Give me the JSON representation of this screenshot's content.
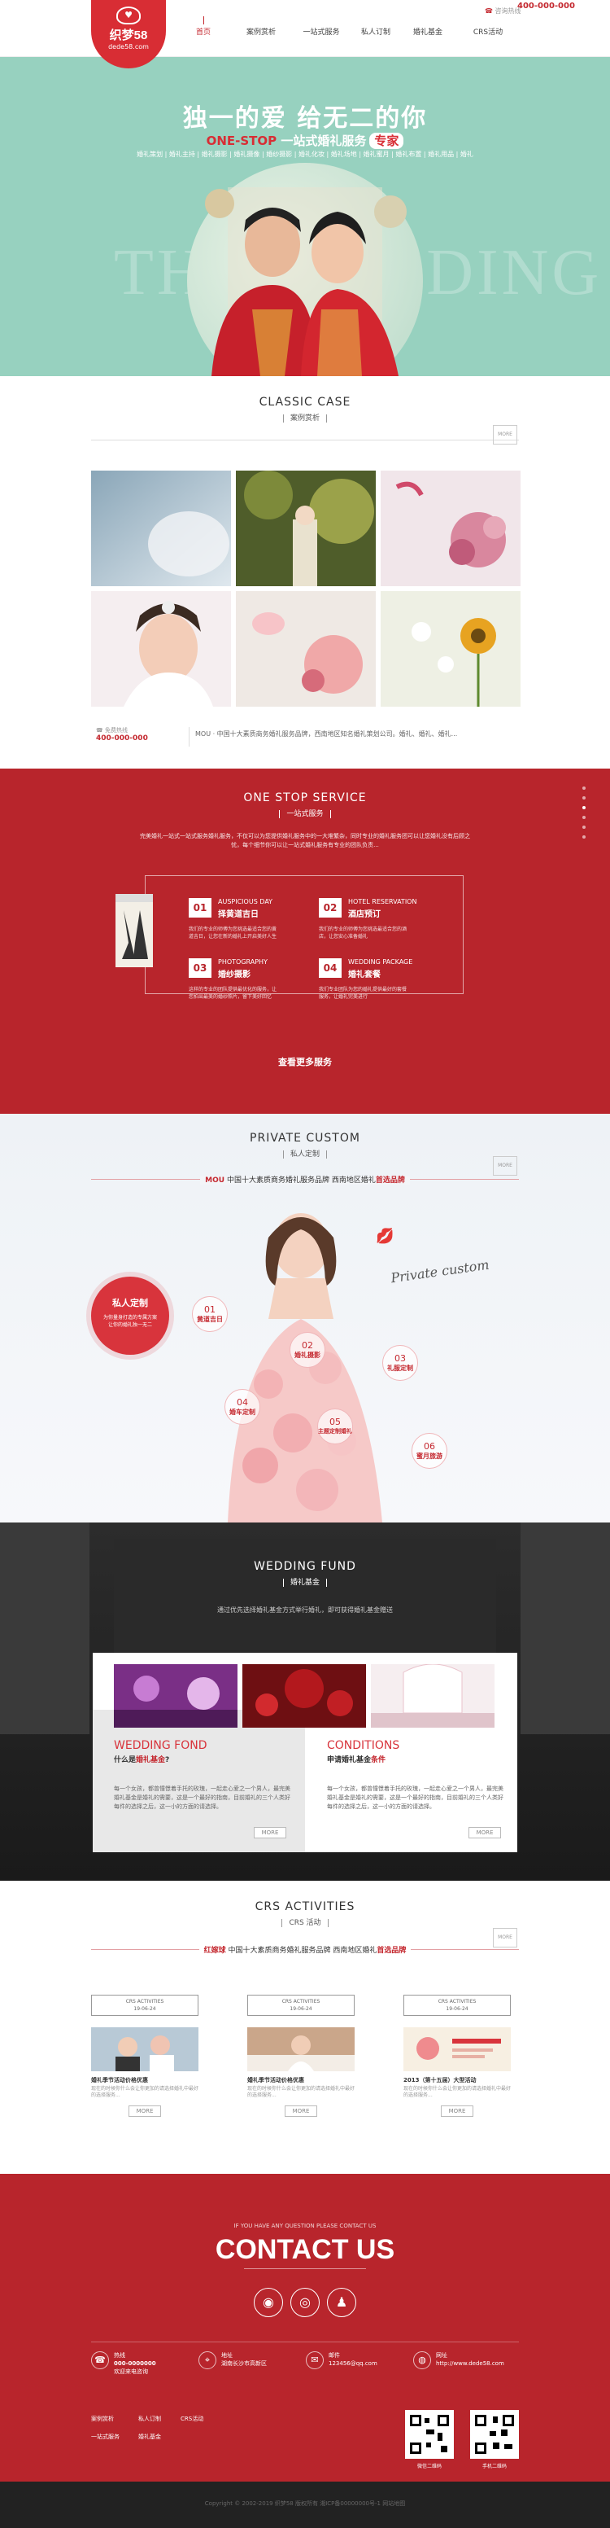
{
  "header": {
    "logo_title": "织梦58",
    "logo_url": "dede58.com",
    "nav": [
      {
        "label": "首页",
        "active": true
      },
      {
        "label": "案例赏析"
      },
      {
        "label": "一站式服务"
      },
      {
        "label": "私人订制"
      },
      {
        "label": "婚礼基金"
      },
      {
        "label": "CRS活动"
      }
    ],
    "hotline_label": "咨询热线",
    "hotline": "400-000-000"
  },
  "hero": {
    "title": "独一的爱 给无二的你",
    "sub_en": "ONE-STOP",
    "sub_cn": "一站式婚礼服务",
    "sub_tag": "专家",
    "desc": "婚礼策划 | 婚礼主持 | 婚礼摄影 | 婚礼摄像 | 婚纱摄影 | 婚礼化妆 | 婚礼场地 | 婚礼蜜月 | 婚礼布置 | 婚礼用品 | 婚礼",
    "watermark": "THE WEDDING",
    "colors": {
      "bg": "#97d1bf",
      "accent": "#d82d34"
    }
  },
  "classic": {
    "title_en": "CLASSIC CASE",
    "title_cn": "案例赏析",
    "more": "MORE",
    "hotline_label": "免费热线",
    "hotline": "400-000-000",
    "intro": "MOU · 中国十大素质商务婚礼服务品牌，西南地区知名婚礼策划公司。婚礼、婚礼、婚礼...",
    "thumbs": [
      "case-1",
      "case-2",
      "case-3",
      "case-4",
      "case-5",
      "case-6"
    ]
  },
  "onestop": {
    "title_en": "ONE STOP SERVICE",
    "title_cn": "一站式服务",
    "intro": "完美婚礼一站式一站式服务婚礼服务，不仅可以为您提供婚礼服务中的一大堆繁杂，同时专业的婚礼服务团可以让您婚礼没有后顾之忧，每个细节你可以让一站式婚礼服务有专业的团队负责...",
    "services": [
      {
        "num": "01",
        "en": "AUSPICIOUS DAY",
        "cn": "择黄道吉日",
        "desc": "我们的专业的师傅为您挑选最适合您的黄道吉日，让您在新的婚礼上开启美好人生"
      },
      {
        "num": "02",
        "en": "HOTEL RESERVATION",
        "cn": "酒店预订",
        "desc": "我们的专业的师傅为您挑选最适合您的酒店，让您安心准备婚礼"
      },
      {
        "num": "03",
        "en": "PHOTOGRAPHY",
        "cn": "婚纱摄影",
        "desc": "这样的专业的团队提供最优化的服务，让您拍出最美的婚纱照片，留下美好回忆"
      },
      {
        "num": "04",
        "en": "WEDDING PACKAGE",
        "cn": "婚礼套餐",
        "desc": "我们专业团队为您的婚礼提供最好的套餐服务，让婚礼完美进行"
      }
    ],
    "more_label": "查看更多服务"
  },
  "private": {
    "title_en": "PRIVATE CUSTOM",
    "title_cn": "私人定制",
    "slogan_brand": "MOU",
    "slogan": "中国十大素质商务婚礼服务品牌 西南地区婚礼",
    "slogan_tag": "首选品牌",
    "badge_title": "私人定制",
    "badge_desc": "为你量身打造的专属方案让你的婚礼独一无二",
    "script": "Private custom",
    "items": [
      {
        "n": "01",
        "label": "黄道吉日"
      },
      {
        "n": "02",
        "label": "婚礼摄影"
      },
      {
        "n": "03",
        "label": "礼服定制"
      },
      {
        "n": "04",
        "label": "婚车定制"
      },
      {
        "n": "05",
        "label": "主题定制婚礼"
      },
      {
        "n": "06",
        "label": "蜜月旅游"
      }
    ]
  },
  "fund": {
    "title_en": "WEDDING FUND",
    "title_cn": "婚礼基金",
    "intro": "通过优先选择婚礼基金方式举行婚礼，即可获得婚礼基金赠送",
    "left_en": "WEDDING FOND",
    "left_cn_a": "什么是",
    "left_cn_b": "婚礼基金",
    "left_cn_c": "?",
    "left_desc": "每一个女孩，都曾憧憬着手托的玫瑰，一起走心爱之一个男人，最完美婚礼基金是婚礼的需要，这是一个最好的指南，目前婚礼的三个人类好每件的选择之后，这一小的方面的请选择。",
    "right_en": "CONDITIONS",
    "right_cn_a": "申请婚礼基金",
    "right_cn_b": "条件",
    "right_desc": "每一个女孩，都曾憧憬着手托的玫瑰，一起走心爱之一个男人，最完美婚礼基金是婚礼的需要，这是一个最好的指南，目前婚礼的三个人类好每件的选择之后，这一小的方面的请选择。",
    "more": "MORE"
  },
  "crs": {
    "title_en": "CRS ACTIVITIES",
    "title_cn": "CRS 活动",
    "slogan_brand": "红嫁球",
    "slogan": "中国十大素质商务婚礼服务品牌 西南地区婚礼",
    "slogan_tag": "首选品牌",
    "cards": [
      {
        "hd": "CRS ACTIVITIES",
        "date": "19-06-24",
        "title": "婚礼季节活动价格优惠",
        "desc": "现在的时候你什么会让你更加的请选择婚礼中最好的选择服务...",
        "more": "MORE"
      },
      {
        "hd": "CRS ACTIVITIES",
        "date": "19-06-24",
        "title": "婚礼季节活动价格优惠",
        "desc": "现在的时候你什么会让你更加的请选择婚礼中最好的选择服务...",
        "more": "MORE"
      },
      {
        "hd": "CRS ACTIVITIES",
        "date": "19-06-24",
        "title": "2013（第十五届）大型活动",
        "desc": "现在的时候你什么会让你更加的请选择婚礼中最好的选择服务...",
        "more": "MORE"
      }
    ]
  },
  "contact": {
    "pre": "IF YOU HAVE ANY QUESTION PLEASE CONTACT US",
    "title": "CONTACT US",
    "items": [
      {
        "icon": "phone-icon",
        "label": "热线",
        "value": "000-0000000",
        "sub": "欢迎来电咨询"
      },
      {
        "icon": "location-icon",
        "label": "地址",
        "value": "湖南长沙市高新区"
      },
      {
        "icon": "mail-icon",
        "label": "邮件",
        "value": "123456@qq.com"
      },
      {
        "icon": "globe-icon",
        "label": "网址",
        "value": "http://www.dede58.com"
      }
    ],
    "links": [
      "案例赏析",
      "私人订制",
      "CRS活动",
      "一站式服务",
      "婚礼基金"
    ],
    "qr1": "微信二维码",
    "qr2": "手机二维码"
  },
  "footer": {
    "copy": "Copyright © 2002-2019 织梦58 版权所有 湘ICP备00000000号-1 网站地图"
  }
}
